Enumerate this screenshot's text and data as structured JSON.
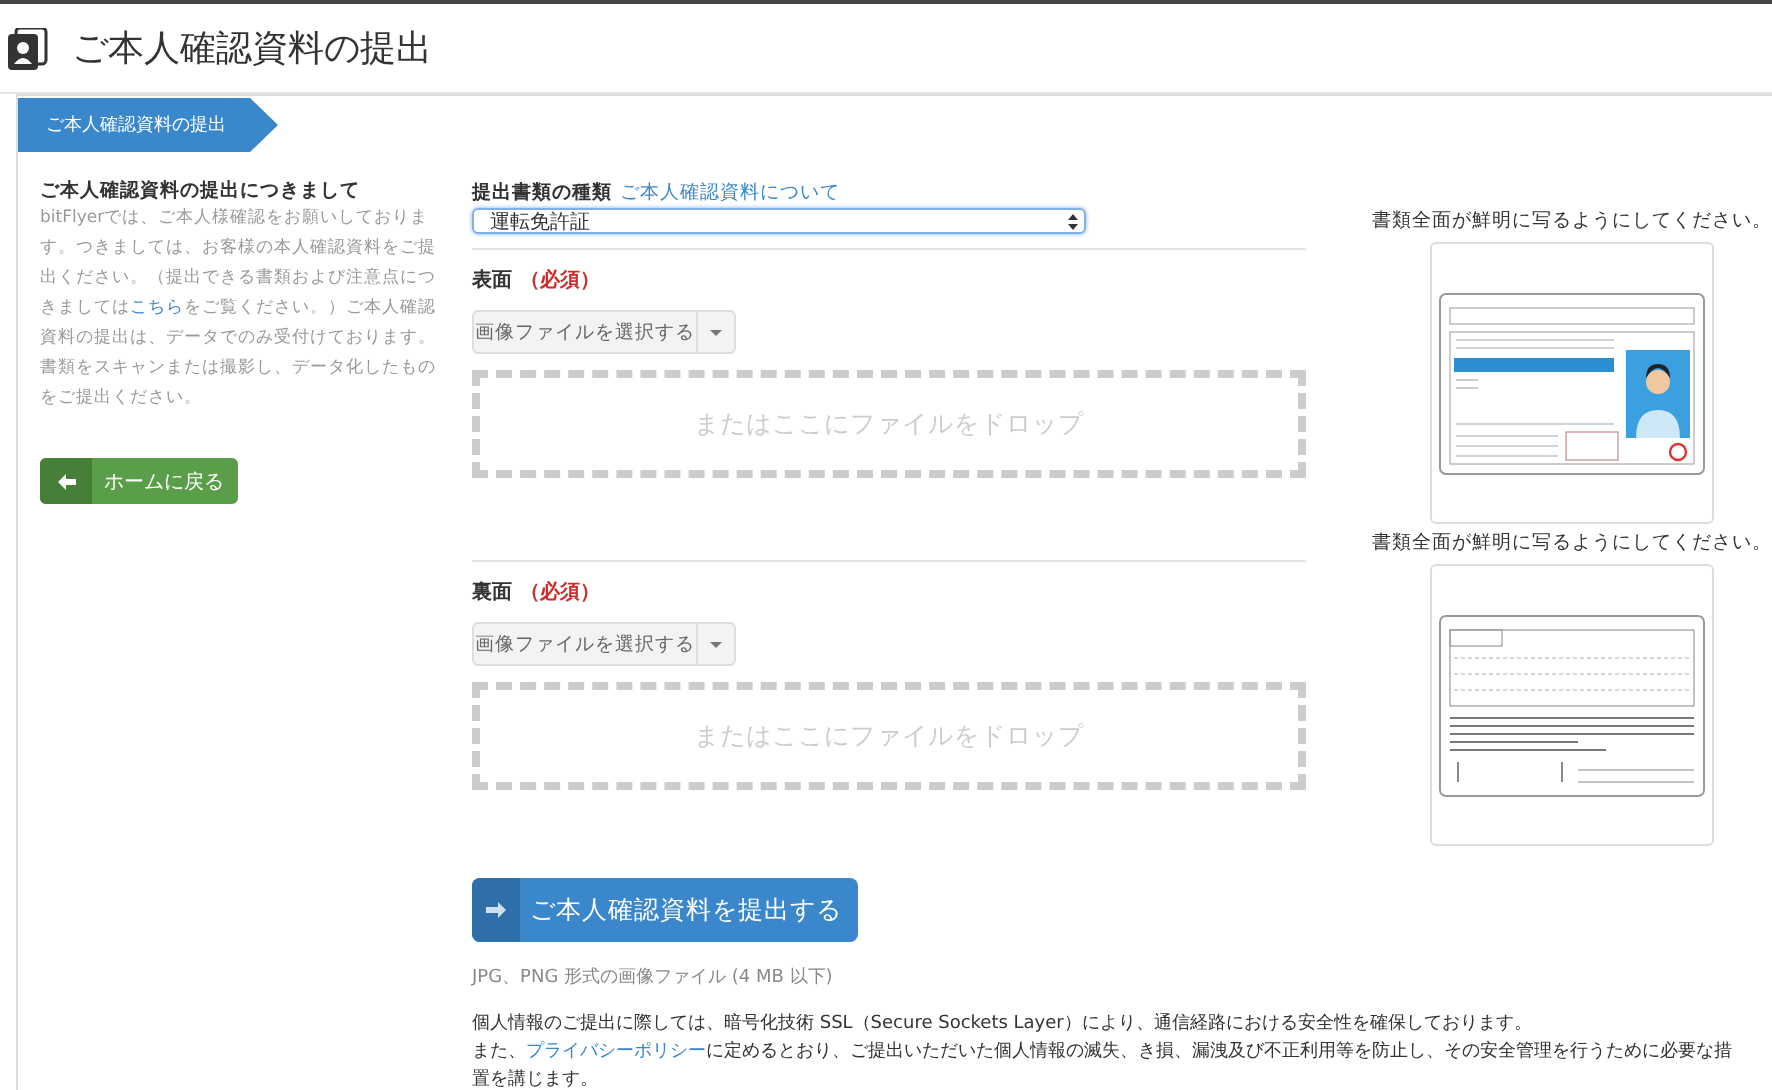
{
  "header": {
    "title": "ご本人確認資料の提出"
  },
  "breadcrumb": {
    "label": "ご本人確認資料の提出"
  },
  "intro": {
    "heading": "ご本人確認資料の提出につきまして",
    "text_before_link": "bitFlyerでは、ご本人様確認をお願いしております。つきましては、お客様の本人確認資料をご提出ください。（提出できる書類および注意点につきましては",
    "link": "こちら",
    "text_after_link": "をご覧ください。）ご本人確認資料の提出は、データでのみ受付けております。書類をスキャンまたは撮影し、データ化したものをご提出ください。"
  },
  "home_button": {
    "label": "ホームに戻る"
  },
  "document_type": {
    "label": "提出書類の種類",
    "link": "ご本人確認資料について",
    "value": "運転免許証"
  },
  "sides": [
    {
      "label": "表面",
      "required_label": "（必須）",
      "file_button": "画像ファイルを選択する",
      "drop_text": "またはここにファイルをドロップ"
    },
    {
      "label": "裏面",
      "required_label": "（必須）",
      "file_button": "画像ファイルを選択する",
      "drop_text": "またはここにファイルをドロップ"
    }
  ],
  "samples": [
    {
      "kind": "front",
      "caption": "書類全面が鮮明に写るようにしてください。"
    },
    {
      "kind": "back",
      "caption": "書類全面が鮮明に写るようにしてください。"
    }
  ],
  "submit_button": {
    "label": "ご本人確認資料を提出する"
  },
  "file_note": "JPG、PNG 形式の画像ファイル (4 MB 以下)",
  "privacy": {
    "line1": "個人情報のご提出に際しては、暗号化技術 SSL（Secure Sockets Layer）により、通信経路における安全性を確保しております。",
    "before_link": "また、",
    "link": "プライバシーポリシー",
    "after_link": "に定めるとおり、ご提出いただいた個人情報の滅失、き損、漏洩及び不正利用等を防止し、その安全管理を行うために必要な措置を講じます。"
  }
}
